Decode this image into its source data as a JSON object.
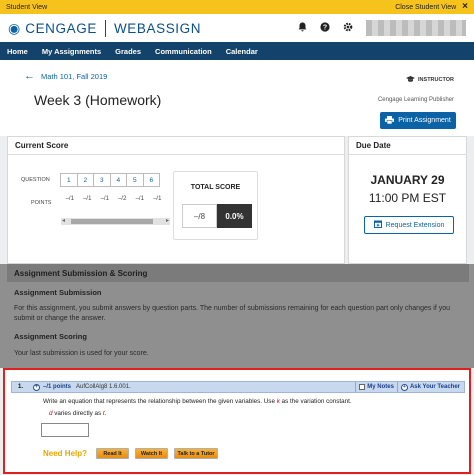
{
  "student_bar": {
    "label": "Student View",
    "close_label": "Close Student View"
  },
  "brand": {
    "part1": "CENGAGE",
    "part2": "WEBASSIGN"
  },
  "top_icons": [
    "bell-icon",
    "help-icon",
    "gear-icon"
  ],
  "nav": {
    "items": [
      "Home",
      "My Assignments",
      "Grades",
      "Communication",
      "Calendar"
    ]
  },
  "header": {
    "course": "Math 101, Fall 2019",
    "title": "Week 3 (Homework)",
    "role": "INSTRUCTOR",
    "publisher": "Cengage Learning Publisher",
    "print_label": "Print Assignment"
  },
  "score": {
    "heading": "Current Score",
    "question_label": "QUESTION",
    "points_label": "POINTS",
    "questions": [
      "1",
      "2",
      "3",
      "4",
      "5",
      "6"
    ],
    "points": [
      "–/1",
      "–/1",
      "–/1",
      "–/2",
      "–/1",
      "–/1"
    ],
    "total_label": "TOTAL SCORE",
    "total_fraction": "–/8",
    "total_percent": "0.0%"
  },
  "due": {
    "heading": "Due Date",
    "date": "JANUARY 29",
    "time": "11:00 PM EST",
    "extension_label": "Request Extension"
  },
  "submission": {
    "heading": "Assignment Submission & Scoring",
    "sub1_title": "Assignment Submission",
    "sub1_text": "For this assignment, you submit answers by question parts. The number of submissions remaining for each question part only changes if you submit or change the answer.",
    "sub2_title": "Assignment Scoring",
    "sub2_text": "Your last submission is used for your score."
  },
  "question": {
    "number": "1.",
    "points": "–/1 points",
    "code": "AufCollAlg8 1.6.001.",
    "my_notes": "My Notes",
    "ask_teacher": "Ask Your Teacher",
    "prompt_before": "Write an equation that represents the relationship between the given variables. Use ",
    "prompt_var": "k",
    "prompt_after": " as the variation constant.",
    "var_d": "d",
    "relation_text": " varies directly as ",
    "var_t": "t",
    "relation_end": "."
  },
  "help": {
    "label": "Need Help?",
    "buttons": [
      "Read It",
      "Watch It",
      "Talk to a Tutor"
    ]
  },
  "colors": {
    "accent": "#0b63a5",
    "nav_bg": "#13426b",
    "student_bar": "#f6c21c",
    "highlight_border": "#e02020",
    "help_label": "#e6a800"
  }
}
